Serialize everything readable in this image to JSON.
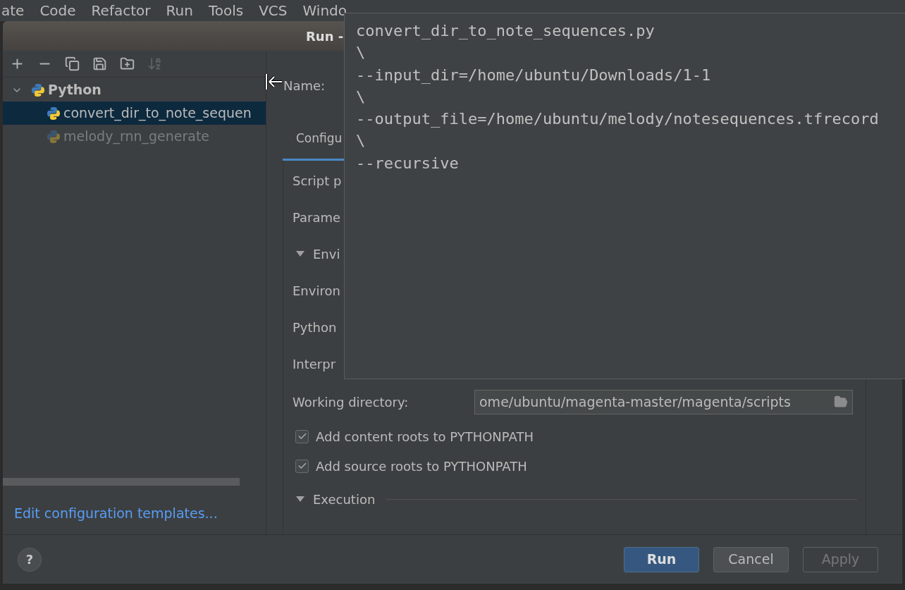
{
  "menu_bar": {
    "items": [
      "ate",
      "Code",
      "Refactor",
      "Run",
      "Tools",
      "VCS",
      "Windo"
    ]
  },
  "dialog": {
    "title": "Run -",
    "toolbar": {
      "buttons": [
        {
          "kind": "add",
          "disabled": false
        },
        {
          "kind": "remove",
          "disabled": false
        },
        {
          "kind": "copy",
          "disabled": false
        },
        {
          "kind": "save",
          "disabled": false
        },
        {
          "kind": "folder",
          "disabled": false
        },
        {
          "kind": "sort",
          "disabled": true
        }
      ]
    },
    "tree": [
      {
        "label": "Python",
        "expanded": true,
        "selected": false,
        "temporary": false,
        "children": [
          {
            "label": "convert_dir_to_note_sequen",
            "selected": true,
            "temporary": false
          },
          {
            "label": "melody_rnn_generate",
            "selected": false,
            "temporary": true
          }
        ]
      }
    ],
    "templates_link": "Edit configuration templates...",
    "name_label": "Name:",
    "tabs": [
      {
        "label": "Configu",
        "selected": true
      }
    ],
    "form": [
      {
        "kind": "label",
        "label": "Script p"
      },
      {
        "kind": "label",
        "label": "Parame"
      },
      {
        "kind": "section",
        "label": "Envi",
        "expanded": true
      },
      {
        "kind": "label",
        "label": "Environ"
      },
      {
        "kind": "label",
        "label": "Python"
      },
      {
        "kind": "label",
        "label": "Interpr"
      },
      {
        "kind": "field",
        "label": "Working directory:",
        "value": "ome/ubuntu/magenta-master/magenta/scripts"
      },
      {
        "kind": "checkbox",
        "label": "Add content roots to PYTHONPATH",
        "checked": true
      },
      {
        "kind": "checkbox",
        "label": "Add source roots to PYTHONPATH",
        "checked": true
      },
      {
        "kind": "section",
        "label": "Execution",
        "expanded": true
      }
    ],
    "help_button": "?",
    "buttons": [
      {
        "label": "Run",
        "kind": "primary",
        "disabled": false
      },
      {
        "label": "Cancel",
        "kind": "normal",
        "disabled": false
      },
      {
        "label": "Apply",
        "kind": "normal",
        "disabled": true
      }
    ]
  },
  "popup": {
    "lines": [
      "convert_dir_to_note_sequences.py",
      "\\",
      "--input_dir=/home/ubuntu/Downloads/1-1",
      "\\",
      "--output_file=/home/ubuntu/melody/notesequences.tfrecord",
      "\\",
      "--recursive"
    ]
  }
}
